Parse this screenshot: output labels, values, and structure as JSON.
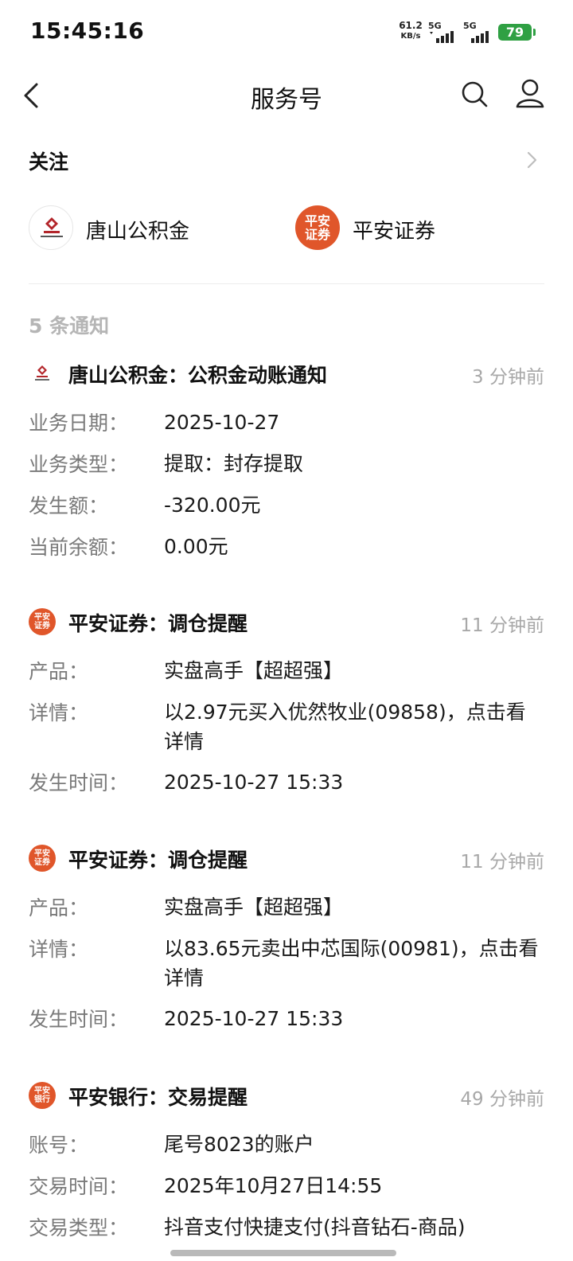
{
  "status_bar": {
    "time": "15:45:16",
    "net_speed_value": "61.2",
    "net_speed_unit": "KB/s",
    "sim1_label": "5G",
    "sim2_label": "5G",
    "battery": "79"
  },
  "nav": {
    "title": "服务号"
  },
  "follow": {
    "title": "关注",
    "accounts": [
      {
        "name": "唐山公积金"
      },
      {
        "name": "平安证券",
        "logo_line1": "平安",
        "logo_line2": "证券"
      }
    ]
  },
  "notice_count": "5 条通知",
  "notices": [
    {
      "title": "唐山公积金：公积金动账通知",
      "time": "3 分钟前",
      "rows": [
        {
          "k": "业务日期：",
          "v": "2025-10-27"
        },
        {
          "k": "业务类型：",
          "v": "提取：封存提取"
        },
        {
          "k": "发生额：",
          "v": "-320.00元"
        },
        {
          "k": "当前余额：",
          "v": "0.00元"
        }
      ]
    },
    {
      "title": "平安证券：调仓提醒",
      "time": "11 分钟前",
      "icon_line1": "平安",
      "icon_line2": "证券",
      "rows": [
        {
          "k": "产品：",
          "v": "实盘高手【超超强】"
        },
        {
          "k": "详情：",
          "v": "以2.97元买入优然牧业(09858)，点击看详情"
        },
        {
          "k": "发生时间：",
          "v": "2025-10-27 15:33"
        }
      ]
    },
    {
      "title": "平安证券：调仓提醒",
      "time": "11 分钟前",
      "icon_line1": "平安",
      "icon_line2": "证券",
      "rows": [
        {
          "k": "产品：",
          "v": "实盘高手【超超强】"
        },
        {
          "k": "详情：",
          "v": "以83.65元卖出中芯国际(00981)，点击看详情"
        },
        {
          "k": "发生时间：",
          "v": "2025-10-27 15:33"
        }
      ]
    },
    {
      "title": "平安银行：交易提醒",
      "time": "49 分钟前",
      "icon_line1": "平安",
      "icon_line2": "银行",
      "rows": [
        {
          "k": "账号：",
          "v": "尾号8023的账户"
        },
        {
          "k": "交易时间：",
          "v": "2025年10月27日14:55"
        },
        {
          "k": "交易类型：",
          "v": "抖音支付快捷支付(抖音钻石-商品)"
        }
      ]
    }
  ],
  "colors": {
    "brand_orange": "#e0562a",
    "gjj_red": "#b3262b",
    "battery_green": "#2fa043"
  }
}
